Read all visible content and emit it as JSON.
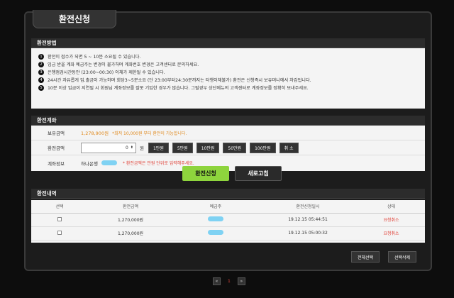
{
  "title": "환전신청",
  "method": {
    "header": "환전방법",
    "items": [
      "환전이 접수가 되면 5 ~ 10분 소요될 수 있습니다.",
      "입금 받을 계좌 예금주는 변경이 불가하며 계좌번호 변경은 고객센터로 문의하세요.",
      "은행점검시간동안 (23:00~00:30) 이체가 제한될 수 있습니다.",
      "24시간 자유롭게 입.출금이 가능하며 회당3~5분소요 (단 23:00부터24:30분까지는 타행이체불가) 환전은 신청즉시 보유머니에서 차감됩니다.",
      "10분 이상 입금이 지연될 시 회원님 계좌정보를 잘못 기입한 경우가 많습니다. 그럴경우 상단메뉴의 고객센터로 계좌정보를 정확히 보내주세요."
    ]
  },
  "account": {
    "header": "환전계좌",
    "balance_label": "보유금액",
    "balance_value": "1,278,900원",
    "min_note": "*최저 10,000원 부터 환전이 가능합니다.",
    "amount_label": "환전금액",
    "amount_value": "0",
    "unit": "원",
    "quick_buttons": [
      "1만원",
      "5만원",
      "10만원",
      "50만원",
      "100만원",
      "취 소"
    ],
    "info_label": "계좌정보",
    "bank_name": "하나은행",
    "unit_note": "* 환전금액은 만원 단위로 입력해주세요."
  },
  "actions": {
    "apply": "환전신청",
    "refresh": "새로고침"
  },
  "history": {
    "header": "환전내역",
    "columns": [
      "선택",
      "환전금액",
      "예금주",
      "환전신청일시",
      "상태"
    ],
    "rows": [
      {
        "amount": "1,270,000원",
        "datetime": "19.12.15 05:44:51",
        "status": "요청취소"
      },
      {
        "amount": "1,270,000원",
        "datetime": "19.12.15 05:00:32",
        "status": "요청취소"
      }
    ],
    "select_all": "전체선택",
    "delete_selected": "선택삭제"
  },
  "pagination": {
    "prev": "«",
    "current": "1",
    "next": "»"
  },
  "colors": {
    "accent_orange": "#e08a1e",
    "accent_red": "#e0433a",
    "apply_green": "#8ed43d"
  }
}
